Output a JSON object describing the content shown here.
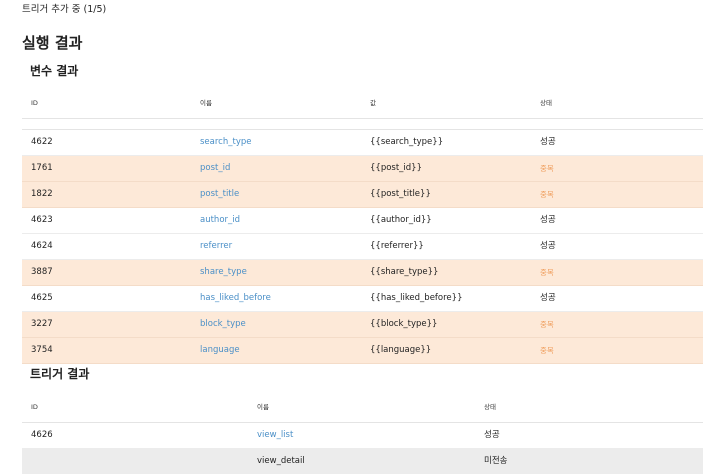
{
  "status_text": "트리거 추가 중 (1/5)",
  "page_title": "실행 결과",
  "variables": {
    "title": "변수 결과",
    "columns": [
      "ID",
      "이름",
      "값",
      "상태"
    ],
    "rows": [
      {
        "id": "4622",
        "name": "search_type",
        "value": "{{search_type}}",
        "status": "성공",
        "type": "ok"
      },
      {
        "id": "1761",
        "name": "post_id",
        "value": "{{post_id}}",
        "status": "중복",
        "type": "dup"
      },
      {
        "id": "1822",
        "name": "post_title",
        "value": "{{post_title}}",
        "status": "중복",
        "type": "dup"
      },
      {
        "id": "4623",
        "name": "author_id",
        "value": "{{author_id}}",
        "status": "성공",
        "type": "ok"
      },
      {
        "id": "4624",
        "name": "referrer",
        "value": "{{referrer}}",
        "status": "성공",
        "type": "ok"
      },
      {
        "id": "3887",
        "name": "share_type",
        "value": "{{share_type}}",
        "status": "중복",
        "type": "dup"
      },
      {
        "id": "4625",
        "name": "has_liked_before",
        "value": "{{has_liked_before}}",
        "status": "성공",
        "type": "ok"
      },
      {
        "id": "3227",
        "name": "block_type",
        "value": "{{block_type}}",
        "status": "중복",
        "type": "dup"
      },
      {
        "id": "3754",
        "name": "language",
        "value": "{{language}}",
        "status": "중복",
        "type": "dup"
      }
    ]
  },
  "triggers": {
    "title": "트리거 결과",
    "columns": [
      "ID",
      "이름",
      "상태"
    ],
    "rows": [
      {
        "id": "4626",
        "name": "view_list",
        "status": "성공",
        "type": "ok"
      },
      {
        "id": "",
        "name": "view_detail",
        "status": "미전송",
        "type": "pending"
      }
    ]
  },
  "colors": {
    "link": "#4a8fc7",
    "duplicate_row_bg": "#fde9d8",
    "duplicate_status": "#f0a060",
    "pending_row_bg": "#ececec"
  }
}
